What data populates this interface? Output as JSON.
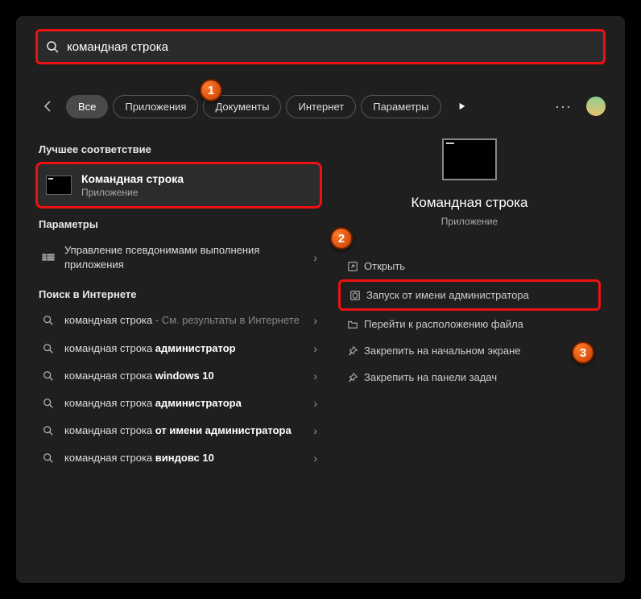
{
  "search": {
    "value": "командная строка"
  },
  "tabs": {
    "all": "Все",
    "apps": "Приложения",
    "docs": "Документы",
    "internet": "Интернет",
    "params": "Параметры"
  },
  "sections": {
    "best": "Лучшее соответствие",
    "params": "Параметры",
    "web": "Поиск в Интернете"
  },
  "bestMatch": {
    "title": "Командная строка",
    "type": "Приложение"
  },
  "settingsItem": "Управление псевдонимами выполнения приложения",
  "web": {
    "r1a": "командная строка",
    "r1b": " - См. результаты в Интернете",
    "r2a": "командная строка ",
    "r2b": "администратор",
    "r3a": "командная строка ",
    "r3b": "windows 10",
    "r4a": "командная строка ",
    "r4b": "администратора",
    "r5a": "командная строка ",
    "r5b": "от имени администратора",
    "r6a": "командная строка ",
    "r6b": "виндовс 10"
  },
  "preview": {
    "title": "Командная строка",
    "type": "Приложение"
  },
  "actions": {
    "open": "Открыть",
    "admin": "Запуск от имени администратора",
    "location": "Перейти к расположению файла",
    "pinStart": "Закрепить на начальном экране",
    "pinTaskbar": "Закрепить на панели задач"
  },
  "badges": {
    "b1": "1",
    "b2": "2",
    "b3": "3"
  }
}
